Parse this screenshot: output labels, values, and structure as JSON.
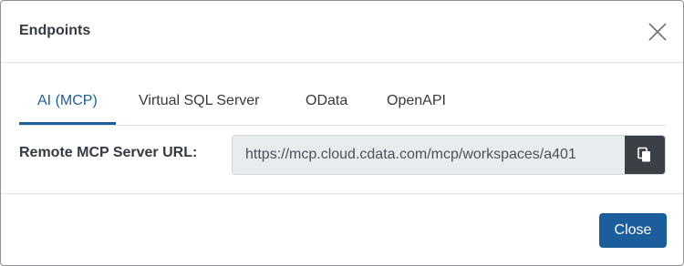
{
  "dialog": {
    "title": "Endpoints",
    "close_icon": "close-icon"
  },
  "tabs": [
    {
      "label": "AI (MCP)",
      "active": true
    },
    {
      "label": "Virtual SQL Server",
      "active": false
    },
    {
      "label": "OData",
      "active": false
    },
    {
      "label": "OpenAPI",
      "active": false
    }
  ],
  "mcp": {
    "label": "Remote MCP Server URL:",
    "url": "https://mcp.cloud.cdata.com/mcp/workspaces/a401",
    "copy_icon": "copy-icon"
  },
  "footer": {
    "close_label": "Close"
  },
  "colors": {
    "accent": "#1b5e9b",
    "copy_button": "#3a4046",
    "url_background": "#e9ecef"
  }
}
